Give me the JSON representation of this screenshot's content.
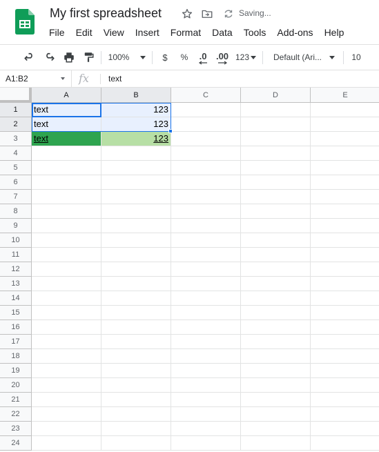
{
  "app": {
    "title": "My first spreadsheet",
    "status": "Saving...",
    "brand_color": "#0f9d58"
  },
  "title_icons": [
    {
      "name": "star-icon"
    },
    {
      "name": "move-to-folder-icon"
    },
    {
      "name": "saving-sync-icon"
    }
  ],
  "menu": [
    "File",
    "Edit",
    "View",
    "Insert",
    "Format",
    "Data",
    "Tools",
    "Add-ons",
    "Help"
  ],
  "toolbar": {
    "zoom": "100%",
    "currency": "$",
    "percent": "%",
    "decrease_decimal": ".0",
    "increase_decimal": ".00",
    "more_formats": "123",
    "font_family": "Default (Ari...",
    "font_size": "10"
  },
  "formula_bar": {
    "name_box": "A1:B2",
    "fx": "fx",
    "value": "text"
  },
  "columns": [
    "A",
    "B",
    "C",
    "D",
    "E"
  ],
  "rows": [
    "1",
    "2",
    "3",
    "4",
    "5",
    "6",
    "7",
    "8",
    "9",
    "10",
    "11",
    "12",
    "13",
    "14",
    "15",
    "16",
    "17",
    "18",
    "19",
    "20",
    "21",
    "22",
    "23",
    "24"
  ],
  "cells": {
    "A1": "text",
    "B1": "123",
    "A2": "text",
    "B2": "123",
    "A3": "text",
    "B3": "123"
  },
  "colors": {
    "selection": "#1a73e8",
    "selection_fill": "#e8f0fe",
    "row3_a_fill": "#2ea44f",
    "row3_b_fill": "#b7dfa5"
  }
}
